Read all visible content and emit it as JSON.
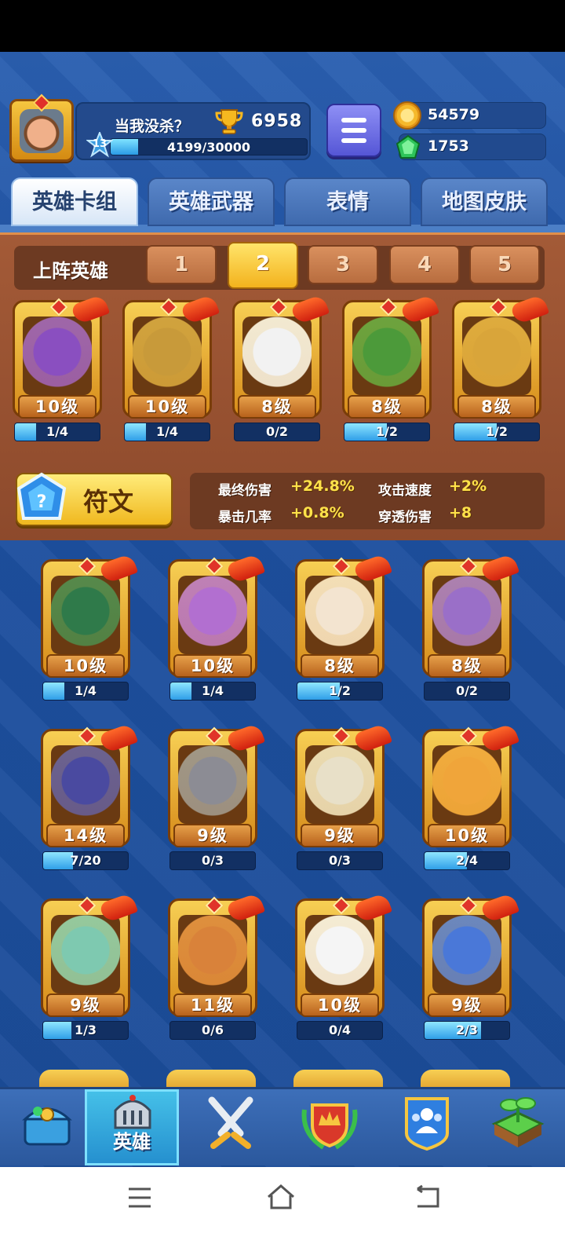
{
  "player": {
    "name": "当我没杀？",
    "level": "13",
    "xp_text": "4199/30000",
    "xp_fraction": 0.14,
    "trophies": "6958"
  },
  "currency": {
    "coins": "54579",
    "gems": "1753"
  },
  "tabs": [
    {
      "label": "英雄卡组",
      "active": true
    },
    {
      "label": "英雄武器",
      "active": false
    },
    {
      "label": "表情",
      "active": false
    },
    {
      "label": "地图皮肤",
      "active": false
    }
  ],
  "lineup": {
    "label": "上阵英雄",
    "slots": [
      "1",
      "2",
      "3",
      "4",
      "5"
    ],
    "active_slot": "2",
    "heroes": [
      {
        "level": "10级",
        "progress": "1/4",
        "fill": 0.25,
        "color": "#8a4fc0"
      },
      {
        "level": "10级",
        "progress": "1/4",
        "fill": 0.25,
        "color": "#c89a3a"
      },
      {
        "level": "8级",
        "progress": "0/2",
        "fill": 0,
        "color": "#f2f2f2"
      },
      {
        "level": "8级",
        "progress": "1/2",
        "fill": 0.5,
        "color": "#4c9a3a"
      },
      {
        "level": "8级",
        "progress": "1/2",
        "fill": 0.5,
        "color": "#d9a53a"
      }
    ]
  },
  "rune": {
    "label": "符文",
    "stats": [
      {
        "label": "最终伤害",
        "value": "+24.8%"
      },
      {
        "label": "攻击速度",
        "value": "+2%"
      },
      {
        "label": "暴击几率",
        "value": "+0.8%"
      },
      {
        "label": "穿透伤害",
        "value": "+8"
      }
    ]
  },
  "collection": [
    {
      "level": "10级",
      "progress": "1/4",
      "fill": 0.25,
      "color": "#2f7a4a"
    },
    {
      "level": "10级",
      "progress": "1/4",
      "fill": 0.25,
      "color": "#b26fd0"
    },
    {
      "level": "8级",
      "progress": "1/2",
      "fill": 0.5,
      "color": "#f3e4d0"
    },
    {
      "level": "8级",
      "progress": "0/2",
      "fill": 0,
      "color": "#9a6fc8"
    },
    {
      "level": "14级",
      "progress": "7/20",
      "fill": 0.35,
      "color": "#4a4aa0"
    },
    {
      "level": "9级",
      "progress": "0/3",
      "fill": 0,
      "color": "#8c8c94"
    },
    {
      "level": "9级",
      "progress": "0/3",
      "fill": 0,
      "color": "#e8e0c8"
    },
    {
      "level": "10级",
      "progress": "2/4",
      "fill": 0.5,
      "color": "#f0a53a"
    },
    {
      "level": "9级",
      "progress": "1/3",
      "fill": 0.33,
      "color": "#7ec9b0"
    },
    {
      "level": "11级",
      "progress": "0/6",
      "fill": 0,
      "color": "#d9823a"
    },
    {
      "level": "10级",
      "progress": "0/4",
      "fill": 0,
      "color": "#f5f5f5"
    },
    {
      "level": "9级",
      "progress": "2/3",
      "fill": 0.67,
      "color": "#4a78d8"
    }
  ],
  "nav": [
    {
      "name": "chest-icon",
      "label": "",
      "active": false
    },
    {
      "name": "hero-helmet-icon",
      "label": "英雄",
      "active": true
    },
    {
      "name": "crossed-swords-icon",
      "label": "",
      "active": false
    },
    {
      "name": "crown-shield-icon",
      "label": "",
      "active": false
    },
    {
      "name": "social-group-icon",
      "label": "",
      "active": false
    },
    {
      "name": "sprout-island-icon",
      "label": "",
      "active": false
    }
  ]
}
